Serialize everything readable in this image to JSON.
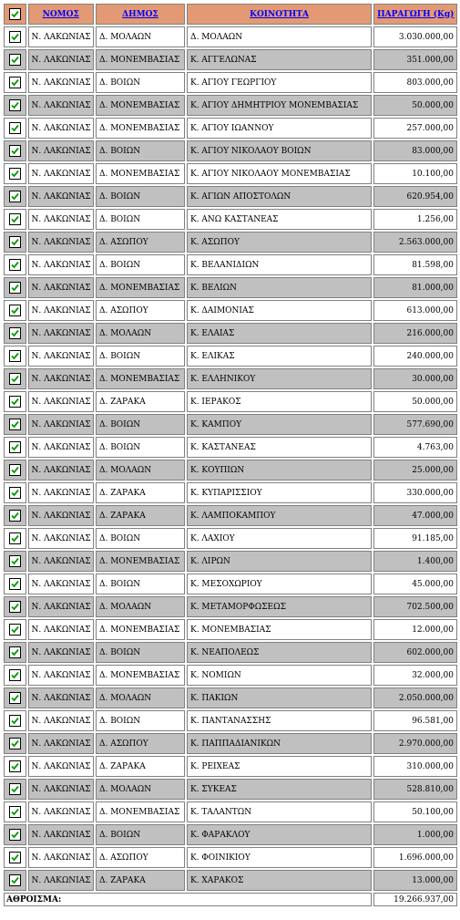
{
  "header": {
    "columns": [
      "ΝΟΜΟΣ",
      "ΔΗΜΟΣ",
      "ΚΟΙΝΟΤΗΤΑ",
      "ΠΑΡΑΓΩΓΗ (Kg)"
    ],
    "select_all_checked": true
  },
  "rows": [
    {
      "nomos": "Ν. ΛΑΚΩΝΙΑΣ",
      "dimos": "Δ. ΜΟΛΑΩΝ",
      "koinotita": "Δ. ΜΟΛΑΩΝ",
      "paragogi": "3.030.000,00",
      "checked": true
    },
    {
      "nomos": "Ν. ΛΑΚΩΝΙΑΣ",
      "dimos": "Δ. ΜΟΝΕΜΒΑΣΙΑΣ",
      "koinotita": "Κ. ΑΓΓΕΛΩΝΑΣ",
      "paragogi": "351.000,00",
      "checked": true
    },
    {
      "nomos": "Ν. ΛΑΚΩΝΙΑΣ",
      "dimos": "Δ. ΒΟΙΩΝ",
      "koinotita": "Κ. ΑΓΙΟΥ ΓΕΩΡΓΙΟΥ",
      "paragogi": "803.000,00",
      "checked": true
    },
    {
      "nomos": "Ν. ΛΑΚΩΝΙΑΣ",
      "dimos": "Δ. ΜΟΝΕΜΒΑΣΙΑΣ",
      "koinotita": "Κ. ΑΓΙΟΥ ΔΗΜΗΤΡΙΟΥ ΜΟΝΕΜΒΑΣΙΑΣ",
      "paragogi": "50.000,00",
      "checked": true
    },
    {
      "nomos": "Ν. ΛΑΚΩΝΙΑΣ",
      "dimos": "Δ. ΜΟΝΕΜΒΑΣΙΑΣ",
      "koinotita": "Κ. ΑΓΙΟΥ ΙΩΑΝΝΟΥ",
      "paragogi": "257.000,00",
      "checked": true
    },
    {
      "nomos": "Ν. ΛΑΚΩΝΙΑΣ",
      "dimos": "Δ. ΒΟΙΩΝ",
      "koinotita": "Κ. ΑΓΙΟΥ ΝΙΚΟΛΑΟΥ ΒΟΙΩΝ",
      "paragogi": "83.000,00",
      "checked": true
    },
    {
      "nomos": "Ν. ΛΑΚΩΝΙΑΣ",
      "dimos": "Δ. ΜΟΝΕΜΒΑΣΙΑΣ",
      "koinotita": "Κ. ΑΓΙΟΥ ΝΙΚΟΛΑΟΥ ΜΟΝΕΜΒΑΣΙΑΣ",
      "paragogi": "10.100,00",
      "checked": true
    },
    {
      "nomos": "Ν. ΛΑΚΩΝΙΑΣ",
      "dimos": "Δ. ΒΟΙΩΝ",
      "koinotita": "Κ. ΑΓΙΩΝ ΑΠΟΣΤΟΛΩΝ",
      "paragogi": "620.954,00",
      "checked": true
    },
    {
      "nomos": "Ν. ΛΑΚΩΝΙΑΣ",
      "dimos": "Δ. ΒΟΙΩΝ",
      "koinotita": "Κ. ΑΝΩ ΚΑΣΤΑΝΕΑΣ",
      "paragogi": "1.256,00",
      "checked": true
    },
    {
      "nomos": "Ν. ΛΑΚΩΝΙΑΣ",
      "dimos": "Δ. ΑΣΩΠΟΥ",
      "koinotita": "Κ. ΑΣΩΠΟΥ",
      "paragogi": "2.563.000,00",
      "checked": true
    },
    {
      "nomos": "Ν. ΛΑΚΩΝΙΑΣ",
      "dimos": "Δ. ΒΟΙΩΝ",
      "koinotita": "Κ. ΒΕΛΑΝΙΔΙΩΝ",
      "paragogi": "81.598,00",
      "checked": true
    },
    {
      "nomos": "Ν. ΛΑΚΩΝΙΑΣ",
      "dimos": "Δ. ΜΟΝΕΜΒΑΣΙΑΣ",
      "koinotita": "Κ. ΒΕΛΙΩΝ",
      "paragogi": "81.000,00",
      "checked": true
    },
    {
      "nomos": "Ν. ΛΑΚΩΝΙΑΣ",
      "dimos": "Δ. ΑΣΩΠΟΥ",
      "koinotita": "Κ. ΔΑΙΜΟΝΙΑΣ",
      "paragogi": "613.000,00",
      "checked": true
    },
    {
      "nomos": "Ν. ΛΑΚΩΝΙΑΣ",
      "dimos": "Δ. ΜΟΛΑΩΝ",
      "koinotita": "Κ. ΕΛΑΙΑΣ",
      "paragogi": "216.000,00",
      "checked": true
    },
    {
      "nomos": "Ν. ΛΑΚΩΝΙΑΣ",
      "dimos": "Δ. ΒΟΙΩΝ",
      "koinotita": "Κ. ΕΛΙΚΑΣ",
      "paragogi": "240.000,00",
      "checked": true
    },
    {
      "nomos": "Ν. ΛΑΚΩΝΙΑΣ",
      "dimos": "Δ. ΜΟΝΕΜΒΑΣΙΑΣ",
      "koinotita": "Κ. ΕΛΛΗΝΙΚΟΥ",
      "paragogi": "30.000,00",
      "checked": true
    },
    {
      "nomos": "Ν. ΛΑΚΩΝΙΑΣ",
      "dimos": "Δ. ΖΑΡΑΚΑ",
      "koinotita": "Κ. ΙΕΡΑΚΟΣ",
      "paragogi": "50.000,00",
      "checked": true
    },
    {
      "nomos": "Ν. ΛΑΚΩΝΙΑΣ",
      "dimos": "Δ. ΒΟΙΩΝ",
      "koinotita": "Κ. ΚΑΜΠΟΥ",
      "paragogi": "577.690,00",
      "checked": true
    },
    {
      "nomos": "Ν. ΛΑΚΩΝΙΑΣ",
      "dimos": "Δ. ΒΟΙΩΝ",
      "koinotita": "Κ. ΚΑΣΤΑΝΕΑΣ",
      "paragogi": "4.763,00",
      "checked": true
    },
    {
      "nomos": "Ν. ΛΑΚΩΝΙΑΣ",
      "dimos": "Δ. ΜΟΛΑΩΝ",
      "koinotita": "Κ. ΚΟΥΠΙΩΝ",
      "paragogi": "25.000,00",
      "checked": true
    },
    {
      "nomos": "Ν. ΛΑΚΩΝΙΑΣ",
      "dimos": "Δ. ΖΑΡΑΚΑ",
      "koinotita": "Κ. ΚΥΠΑΡΙΣΣΙΟΥ",
      "paragogi": "330.000,00",
      "checked": true
    },
    {
      "nomos": "Ν. ΛΑΚΩΝΙΑΣ",
      "dimos": "Δ. ΖΑΡΑΚΑ",
      "koinotita": "Κ. ΛΑΜΠΟΚΑΜΠΟΥ",
      "paragogi": "47.000,00",
      "checked": true
    },
    {
      "nomos": "Ν. ΛΑΚΩΝΙΑΣ",
      "dimos": "Δ. ΒΟΙΩΝ",
      "koinotita": "Κ. ΛΑΧΙΟΥ",
      "paragogi": "91.185,00",
      "checked": true
    },
    {
      "nomos": "Ν. ΛΑΚΩΝΙΑΣ",
      "dimos": "Δ. ΜΟΝΕΜΒΑΣΙΑΣ",
      "koinotita": "Κ. ΛΙΡΩΝ",
      "paragogi": "1.400,00",
      "checked": true
    },
    {
      "nomos": "Ν. ΛΑΚΩΝΙΑΣ",
      "dimos": "Δ. ΒΟΙΩΝ",
      "koinotita": "Κ. ΜΕΣΟΧΩΡΙΟΥ",
      "paragogi": "45.000,00",
      "checked": true
    },
    {
      "nomos": "Ν. ΛΑΚΩΝΙΑΣ",
      "dimos": "Δ. ΜΟΛΑΩΝ",
      "koinotita": "Κ. ΜΕΤΑΜΟΡΦΩΣΕΩΣ",
      "paragogi": "702.500,00",
      "checked": true
    },
    {
      "nomos": "Ν. ΛΑΚΩΝΙΑΣ",
      "dimos": "Δ. ΜΟΝΕΜΒΑΣΙΑΣ",
      "koinotita": "Κ. ΜΟΝΕΜΒΑΣΙΑΣ",
      "paragogi": "12.000,00",
      "checked": true
    },
    {
      "nomos": "Ν. ΛΑΚΩΝΙΑΣ",
      "dimos": "Δ. ΒΟΙΩΝ",
      "koinotita": "Κ. ΝΕΑΠΟΛΕΩΣ",
      "paragogi": "602.000,00",
      "checked": true
    },
    {
      "nomos": "Ν. ΛΑΚΩΝΙΑΣ",
      "dimos": "Δ. ΜΟΝΕΜΒΑΣΙΑΣ",
      "koinotita": "Κ. ΝΟΜΙΩΝ",
      "paragogi": "32.000,00",
      "checked": true
    },
    {
      "nomos": "Ν. ΛΑΚΩΝΙΑΣ",
      "dimos": "Δ. ΜΟΛΑΩΝ",
      "koinotita": "Κ. ΠΑΚΙΩΝ",
      "paragogi": "2.050.000,00",
      "checked": true
    },
    {
      "nomos": "Ν. ΛΑΚΩΝΙΑΣ",
      "dimos": "Δ. ΒΟΙΩΝ",
      "koinotita": "Κ. ΠΑΝΤΑΝΑΣΣΗΣ",
      "paragogi": "96.581,00",
      "checked": true
    },
    {
      "nomos": "Ν. ΛΑΚΩΝΙΑΣ",
      "dimos": "Δ. ΑΣΩΠΟΥ",
      "koinotita": "Κ. ΠΑΠΠΑΔΙΑΝΙΚΩΝ",
      "paragogi": "2.970.000,00",
      "checked": true
    },
    {
      "nomos": "Ν. ΛΑΚΩΝΙΑΣ",
      "dimos": "Δ. ΖΑΡΑΚΑ",
      "koinotita": "Κ. ΡΕΙΧΕΑΣ",
      "paragogi": "310.000,00",
      "checked": true
    },
    {
      "nomos": "Ν. ΛΑΚΩΝΙΑΣ",
      "dimos": "Δ. ΜΟΛΑΩΝ",
      "koinotita": "Κ. ΣΥΚΕΑΣ",
      "paragogi": "528.810,00",
      "checked": true
    },
    {
      "nomos": "Ν. ΛΑΚΩΝΙΑΣ",
      "dimos": "Δ. ΜΟΝΕΜΒΑΣΙΑΣ",
      "koinotita": "Κ. ΤΑΛΑΝΤΩΝ",
      "paragogi": "50.100,00",
      "checked": true
    },
    {
      "nomos": "Ν. ΛΑΚΩΝΙΑΣ",
      "dimos": "Δ. ΒΟΙΩΝ",
      "koinotita": "Κ. ΦΑΡΑΚΛΟΥ",
      "paragogi": "1.000,00",
      "checked": true
    },
    {
      "nomos": "Ν. ΛΑΚΩΝΙΑΣ",
      "dimos": "Δ. ΑΣΩΠΟΥ",
      "koinotita": "Κ. ΦΟΙΝΙΚΙΟΥ",
      "paragogi": "1.696.000,00",
      "checked": true
    },
    {
      "nomos": "Ν. ΛΑΚΩΝΙΑΣ",
      "dimos": "Δ. ΖΑΡΑΚΑ",
      "koinotita": "Κ. ΧΑΡΑΚΟΣ",
      "paragogi": "13.000,00",
      "checked": true
    }
  ],
  "footer": {
    "label": "ΑΘΡΟΙΣΜΑ:",
    "total": "19.266.937,00"
  },
  "colors": {
    "header_bg": "#e39a74",
    "link": "#0000ff",
    "alt_row_bg": "#c0c0c0",
    "check_green": "#009a00"
  }
}
